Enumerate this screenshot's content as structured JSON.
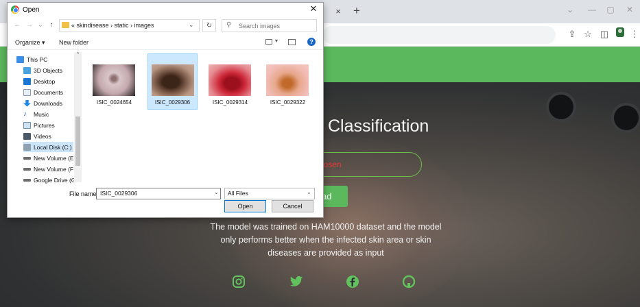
{
  "browser": {
    "tab_close": "×",
    "new_tab": "+",
    "window_buttons": [
      "⌄",
      "—",
      "▢",
      "✕"
    ],
    "toolbar_icons": [
      "share-icon",
      "star-icon",
      "sidepanel-icon",
      "profile-icon",
      "menu-icon"
    ]
  },
  "site": {
    "title": "Classification",
    "file_status": "hosen",
    "upload_label": "ad",
    "description": "The model was trained on HAM10000 dataset and the model only performs better when the infected skin area or skin diseases are provided as input",
    "social": [
      "instagram-icon",
      "twitter-icon",
      "facebook-icon",
      "github-icon"
    ],
    "accent_color": "#5cb85c"
  },
  "dialog": {
    "title": "Open",
    "close": "✕",
    "address": {
      "crumbs": "« skindisease › static › images"
    },
    "search_placeholder": "Search images",
    "organize": "Organize ▾",
    "new_folder": "New folder",
    "help": "?",
    "tree": [
      {
        "label": "This PC",
        "icon": "pc-icon"
      },
      {
        "label": "3D Objects",
        "icon": "cube-icon"
      },
      {
        "label": "Desktop",
        "icon": "desktop-icon"
      },
      {
        "label": "Documents",
        "icon": "documents-icon"
      },
      {
        "label": "Downloads",
        "icon": "downloads-icon"
      },
      {
        "label": "Music",
        "icon": "music-icon"
      },
      {
        "label": "Pictures",
        "icon": "pictures-icon"
      },
      {
        "label": "Videos",
        "icon": "videos-icon"
      },
      {
        "label": "Local Disk (C:)",
        "icon": "disk-icon"
      },
      {
        "label": "New Volume (E:)",
        "icon": "drive-icon"
      },
      {
        "label": "New Volume (F:)",
        "icon": "drive-icon"
      },
      {
        "label": "Google Drive (G:",
        "icon": "drive-icon"
      }
    ],
    "files": [
      {
        "name": "ISIC_0024654"
      },
      {
        "name": "ISIC_0029306"
      },
      {
        "name": "ISIC_0029314"
      },
      {
        "name": "ISIC_0029322"
      }
    ],
    "file_name_label": "File name:",
    "file_name_value": "ISIC_0029306",
    "file_type": "All Files",
    "open_label": "Open",
    "cancel_label": "Cancel"
  }
}
